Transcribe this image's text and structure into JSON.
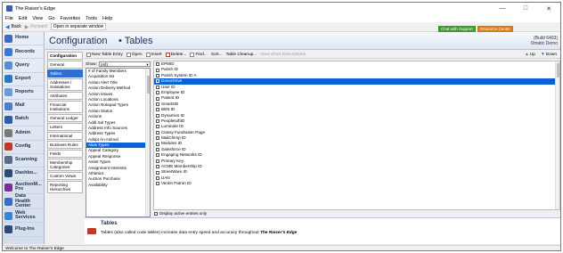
{
  "window": {
    "title": "The Raiser's Edge"
  },
  "menu": [
    "File",
    "Edit",
    "View",
    "Go",
    "Favorites",
    "Tools",
    "Help"
  ],
  "nav_toolbar": {
    "back": "Back",
    "forward": "Forward",
    "open_separate": "Open in separate window"
  },
  "sidebar": [
    {
      "label": "Home",
      "color": "#3a6cc7"
    },
    {
      "label": "Records",
      "color": "#3a7ad6"
    },
    {
      "label": "Query",
      "color": "#5a8fd8"
    },
    {
      "label": "Export",
      "color": "#2a79c9"
    },
    {
      "label": "Reports",
      "color": "#6a9bd8"
    },
    {
      "label": "Mail",
      "color": "#4b7fc9"
    },
    {
      "label": "Batch",
      "color": "#2c5fa8"
    },
    {
      "label": "Admin",
      "color": "#7a7a7a"
    },
    {
      "label": "Config",
      "color": "#c0392b"
    },
    {
      "label": "Scanning",
      "color": "#5b6c8a"
    },
    {
      "label": "Dashbo...",
      "color": "#2d4a7a"
    },
    {
      "label": "AuctionM...\nPro",
      "color": "#7c2d9c"
    },
    {
      "label": "Data\nHealth\nCenter",
      "color": "#3a6cc7"
    },
    {
      "label": "Web\nServices",
      "color": "#3a85d6"
    },
    {
      "label": "Plug-Ins",
      "color": "#2d4a7a"
    }
  ],
  "header": {
    "section": "Configuration",
    "page": "• Tables",
    "chat_button": "Chat with Support",
    "resource_button": "Resource Center",
    "build": "(Build 6403)",
    "edition": "Omatic Demo"
  },
  "tabs": [
    "Configuration",
    "General",
    "Tables",
    "Addresses / Salutations",
    "Attributes",
    "Financial Institutions",
    "General Ledger",
    "Letters",
    "International",
    "Business Rules",
    "Fields",
    "Membership Categories",
    "Custom Views",
    "Reporting Hierarchies"
  ],
  "active_tab": "Tables",
  "toolbar2": {
    "new_table_entry": "New Table Entry",
    "open": "Open",
    "insert": "Insert",
    "delete": "Delete...",
    "find": "Find...",
    "sort": "Sort...",
    "table_cleanup": "Table Cleanup...",
    "view_short": "View Short Descriptions",
    "up": "Up",
    "down": "Down"
  },
  "show_label": "Show:",
  "show_value": "(All)",
  "tables_list": [
    "# of Family Members",
    "Acquisition list",
    "Action Alert Title",
    "Action Delivery Method",
    "Action Issues",
    "Action Locations",
    "Action Notepad Types",
    "Action Status",
    "Actions",
    "Addl.Sal Types",
    "Address Info Sources",
    "Address Types",
    "Adopt An Animal",
    "Alias Types",
    "Appeal Category",
    "Appeal Response",
    "Asset Types",
    "Assignment Interests",
    "Athletics",
    "Auction Purchase",
    "Availability"
  ],
  "tables_selected": "Alias Types",
  "entries_list": [
    "EPMID",
    "Parish ID",
    "Parish System ID A",
    "DonorDrive",
    "User ID",
    "Employee ID",
    "Patient ID",
    "SmartsID",
    "BEN ID",
    "Dynamics ID",
    "PeoplesoftID",
    "Luminate ID",
    "Classy Fundraiser Page",
    "MailChimp ID",
    "Modules ID",
    "Salesforce ID",
    "Engaging Networks ID",
    "Primary Key",
    "ACME Membership ID",
    "StreetWare ID",
    "UAN",
    "Verdin Patron ID"
  ],
  "entries_selected": "DonorDrive",
  "display_active": "Display active entries only",
  "info": {
    "title": "Tables",
    "desc_prefix": "Tables (also called code tables) increase data entry speed and accuracy throughout ",
    "desc_app": "The Raiser's Edge"
  },
  "status": "Welcome to The Raiser's Edge"
}
